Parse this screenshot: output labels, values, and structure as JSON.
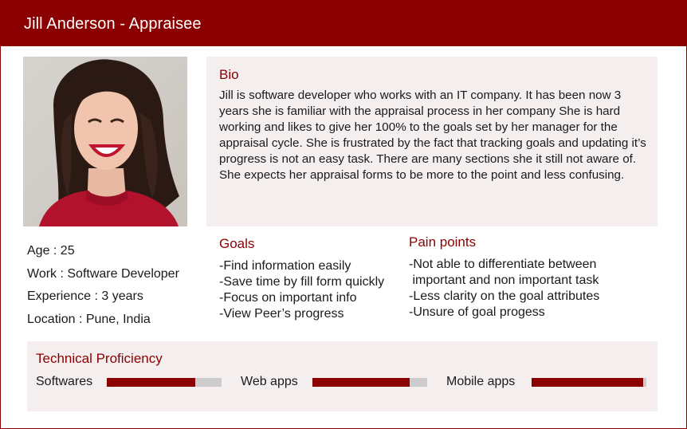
{
  "header": {
    "title": "Jill Anderson - Appraisee"
  },
  "photo": {
    "alt": "Portrait of smiling woman in red top"
  },
  "bio": {
    "heading": "Bio",
    "text": "Jill is software developer who works with an IT company. It has been now 3 years she is familiar with the appraisal process in her company She is hard working and likes to give her 100% to the goals set by her manager for the appraisal cycle. She is frustrated by the fact that tracking goals and updating it’s progress is not an easy task. There are many sections she it still not aware of. She expects her appraisal forms to be more to the point and less confusing."
  },
  "facts": [
    "Age : 25",
    "Work : Software Developer",
    "Experience : 3 years",
    "Location : Pune, India"
  ],
  "goals": {
    "heading": "Goals",
    "items": [
      "-Find information easily",
      "-Save time by fill form quickly",
      "-Focus on important info",
      "-View Peer’s progress"
    ]
  },
  "pain_points": {
    "heading": "Pain points",
    "items": [
      "-Not able to differentiate between",
      " important and non important task",
      "-Less clarity on the goal attributes",
      "-Unsure of goal progess"
    ]
  },
  "technical_proficiency": {
    "heading": "Technical Proficiency",
    "skills": [
      {
        "label": "Softwares",
        "level": 0.77
      },
      {
        "label": "Web apps",
        "level": 0.85
      },
      {
        "label": "Mobile apps",
        "level": 0.97
      }
    ]
  },
  "colors": {
    "accent": "#8b0000",
    "panel": "#f5eeee",
    "track": "#cccccc"
  }
}
